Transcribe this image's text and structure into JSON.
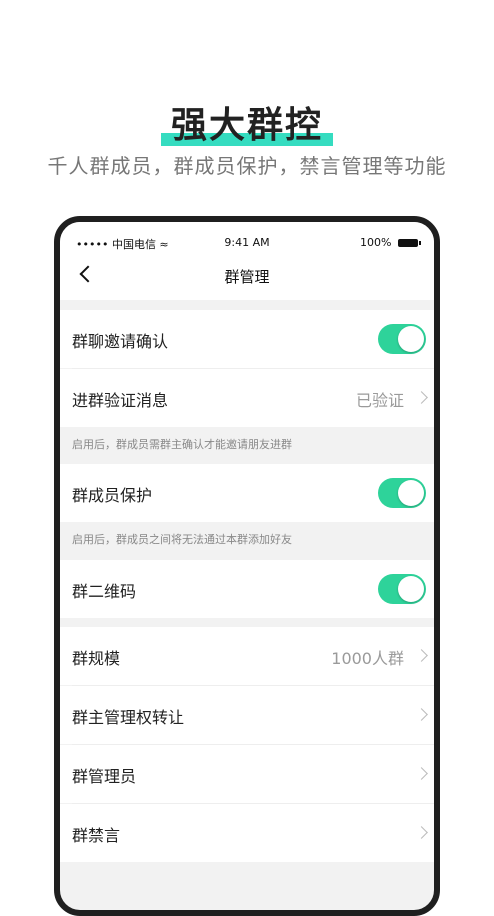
{
  "headline": {
    "title": "强大群控",
    "subtitle": "千人群成员，群成员保护，禁言管理等功能"
  },
  "status_bar": {
    "carrier": "••••• 中国电信 ≈",
    "time": "9:41 AM",
    "battery": "100%"
  },
  "nav": {
    "title": "群管理"
  },
  "settings": {
    "invite_confirm": {
      "label": "群聊邀请确认",
      "enabled": true
    },
    "join_verify": {
      "label": "进群验证消息",
      "value": "已验证"
    },
    "note_invite": "启用后，群成员需群主确认才能邀请朋友进群",
    "member_protect": {
      "label": "群成员保护",
      "enabled": true
    },
    "note_protect": "启用后，群成员之间将无法通过本群添加好友",
    "qr_code": {
      "label": "群二维码",
      "enabled": true
    },
    "group_size": {
      "label": "群规模",
      "value": "1000人群"
    },
    "transfer_owner": {
      "label": "群主管理权转让"
    },
    "admins": {
      "label": "群管理员"
    },
    "mute": {
      "label": "群禁言"
    }
  },
  "colors": {
    "accent_green": "#2ed39a",
    "highlight_teal": "#35dcc0"
  }
}
